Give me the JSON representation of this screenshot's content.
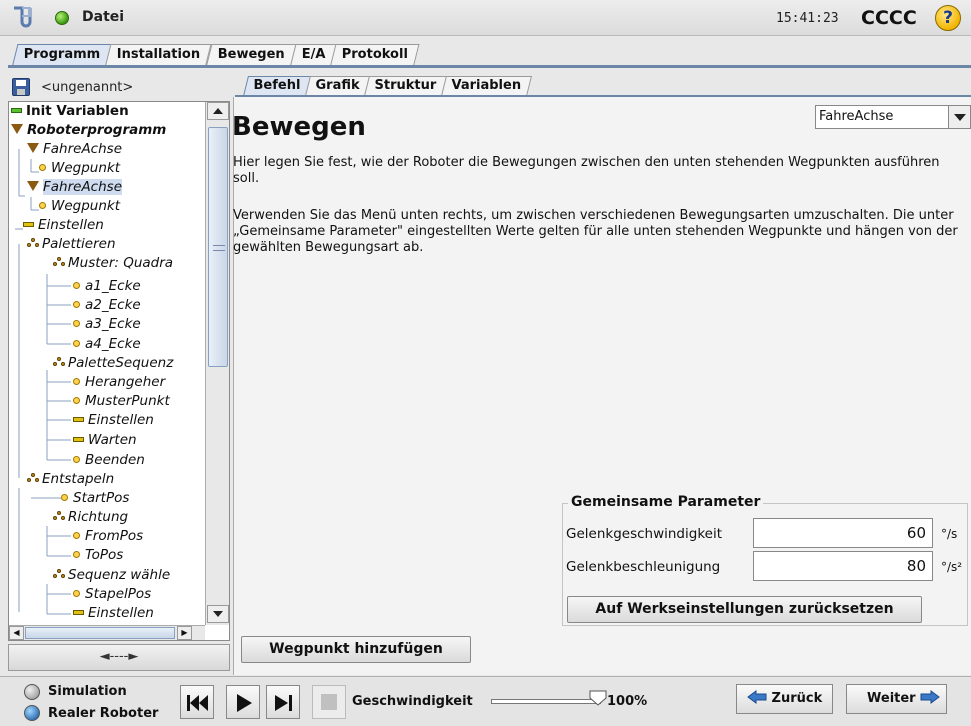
{
  "titlebar": {
    "file_menu": "Datei",
    "clock": "15:41:23",
    "robot_name": "CCCC",
    "help_symbol": "?"
  },
  "main_tabs": [
    {
      "label": "Programm",
      "active": true
    },
    {
      "label": "Installation"
    },
    {
      "label": "Bewegen"
    },
    {
      "label": "E/A"
    },
    {
      "label": "Protokoll"
    }
  ],
  "program": {
    "name": "<ungenannt>"
  },
  "tree": [
    {
      "label": "Init Variablen",
      "icon": "green-bar-icon"
    },
    {
      "label": "Roboterprogramm",
      "icon": "folder-triangle-icon"
    },
    {
      "label": "FahreAchse",
      "icon": "move-triangle-icon"
    },
    {
      "label": "Wegpunkt",
      "icon": "waypoint-icon"
    },
    {
      "label": "FahreAchse",
      "icon": "move-triangle-icon"
    },
    {
      "label": "Wegpunkt",
      "icon": "waypoint-icon"
    },
    {
      "label": "Einstellen",
      "icon": "set-bar-icon"
    },
    {
      "label": "Palettieren",
      "icon": "pattern-icon"
    },
    {
      "label": "Muster: Quadra",
      "icon": "pattern-icon"
    },
    {
      "label": "a1_Ecke",
      "icon": "waypoint-icon"
    },
    {
      "label": "a2_Ecke",
      "icon": "waypoint-icon"
    },
    {
      "label": "a3_Ecke",
      "icon": "waypoint-icon"
    },
    {
      "label": "a4_Ecke",
      "icon": "waypoint-icon"
    },
    {
      "label": "PaletteSequenz",
      "icon": "pattern-icon"
    },
    {
      "label": "Herangeher",
      "icon": "waypoint-icon"
    },
    {
      "label": "MusterPunkt",
      "icon": "waypoint-icon"
    },
    {
      "label": "Einstellen",
      "icon": "set-bar-icon"
    },
    {
      "label": "Warten",
      "icon": "set-bar-icon"
    },
    {
      "label": "Beenden",
      "icon": "waypoint-icon"
    },
    {
      "label": "Entstapeln",
      "icon": "pattern-icon"
    },
    {
      "label": "StartPos",
      "icon": "waypoint-icon"
    },
    {
      "label": "Richtung",
      "icon": "pattern-icon"
    },
    {
      "label": "FromPos",
      "icon": "waypoint-icon"
    },
    {
      "label": "ToPos",
      "icon": "waypoint-icon"
    },
    {
      "label": "Sequenz wähle",
      "icon": "pattern-icon"
    },
    {
      "label": "StapelPos",
      "icon": "waypoint-icon"
    },
    {
      "label": "Einstellen",
      "icon": "set-bar-icon"
    }
  ],
  "tree_nav_label": "◄----►",
  "sub_tabs": [
    {
      "label": "Befehl",
      "active": true
    },
    {
      "label": "Grafik"
    },
    {
      "label": "Struktur"
    },
    {
      "label": "Variablen"
    }
  ],
  "command": {
    "title": "Bewegen",
    "type_select": "FahreAchse",
    "para1": "Hier legen Sie fest, wie der Roboter die Bewegungen zwischen den unten stehenden Wegpunkten ausführen soll.",
    "para2": "Verwenden Sie das Menü unten rechts, um zwischen verschiedenen Bewegungsarten umzuschalten. Die unter „Gemeinsame Parameter\" eingestellten Werte gelten für alle unten stehenden Wegpunkte und hängen von der gewählten Bewegungsart ab."
  },
  "params": {
    "legend": "Gemeinsame Parameter",
    "speed_label": "Gelenkgeschwindigkeit",
    "speed_value": "60",
    "speed_unit": "°/s",
    "accel_label": "Gelenkbeschleunigung",
    "accel_value": "80",
    "accel_unit": "°/s²",
    "reset_label": "Auf Werkseinstellungen zurücksetzen"
  },
  "add_waypoint_label": "Wegpunkt hinzufügen",
  "footer": {
    "sim_label": "Simulation",
    "real_label": "Realer Roboter",
    "speed_label": "Geschwindigkeit",
    "speed_value": "100%",
    "speed_fraction": 1.0,
    "back_label": "Zurück",
    "next_label": "Weiter"
  },
  "colors": {
    "accent": "#6c86a8",
    "selected": "#cfdcf0",
    "status_ok": "#3a9a10",
    "nav_arrow": "#3a78c8"
  }
}
